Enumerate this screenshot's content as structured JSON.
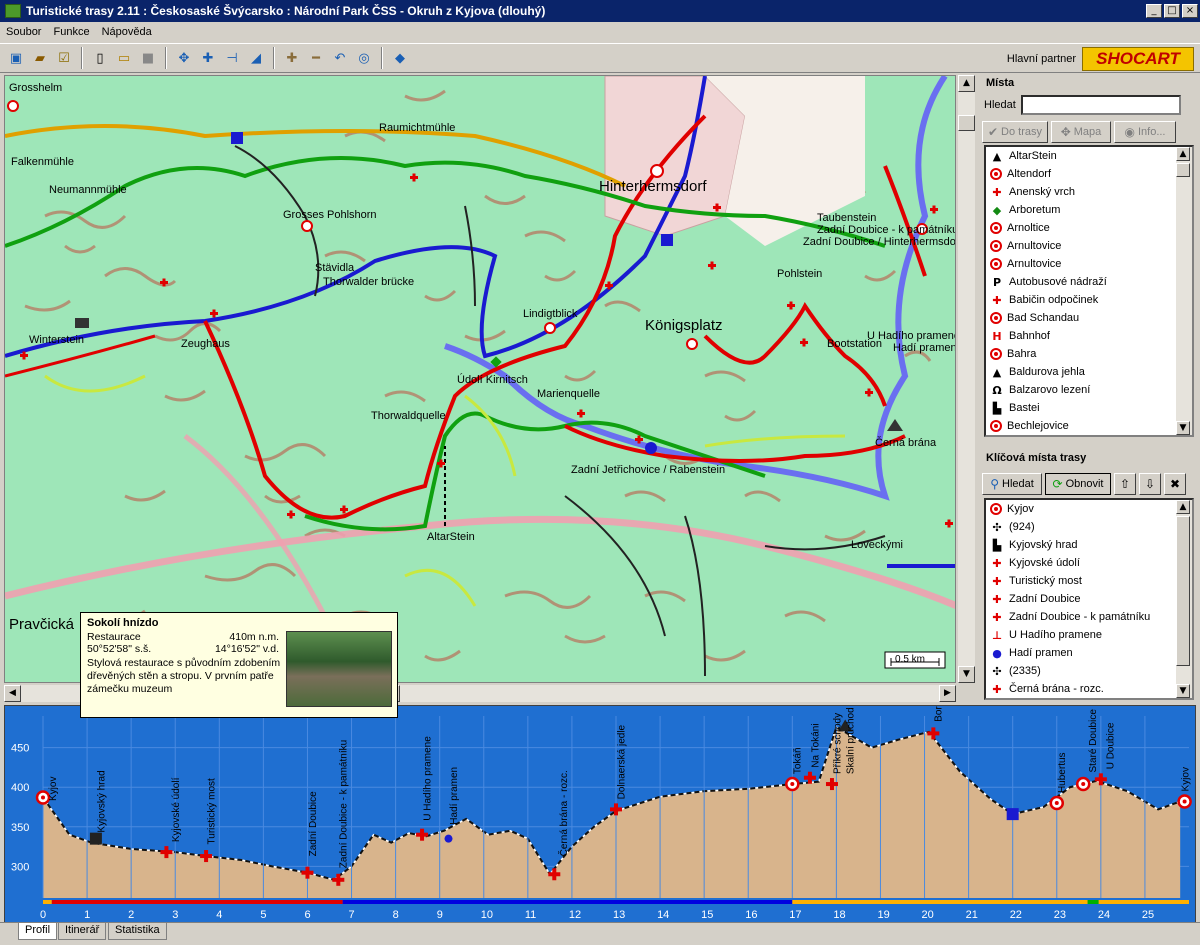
{
  "window": {
    "title": "Turistické trasy 2.11 : Českosaské Švýcarsko : Národní Park ČSS - Okruh z Kyjova (dlouhý)",
    "controls": [
      "_",
      "□",
      "×"
    ]
  },
  "menu": [
    "Soubor",
    "Funkce",
    "Nápověda"
  ],
  "toolbar": {
    "partner_label": "Hlavní partner",
    "logo_text": "SHOCART"
  },
  "map": {
    "labels": [
      {
        "text": "Grosshelm"
      },
      {
        "text": "Falkenmühle"
      },
      {
        "text": "Neumannmühle"
      },
      {
        "text": "Raumichtmühle"
      },
      {
        "text": "Grosses Pohlshorn"
      },
      {
        "text": "Stävidla"
      },
      {
        "text": "Thorwalder brücke"
      },
      {
        "text": "Winterstein"
      },
      {
        "text": "Zeughaus"
      },
      {
        "text": "Thorwaldquelle"
      },
      {
        "text": "Lindigtblick"
      },
      {
        "text": "Údolí Kirnitsch"
      },
      {
        "text": "Marienquelle"
      },
      {
        "text": "Hinterhermsdorf"
      },
      {
        "text": "Königsplatz"
      },
      {
        "text": "Taubenstein"
      },
      {
        "text": "Zadní Doubice - k památníku"
      },
      {
        "text": "Zadní Doubice / Hinterhermsdorf"
      },
      {
        "text": "Pohlstein"
      },
      {
        "text": "U Hadího pramene"
      },
      {
        "text": "Bootstation"
      },
      {
        "text": "Hadí pramen"
      },
      {
        "text": "Zadní Jetřichovice / Rabenstein"
      },
      {
        "text": "Černá brána"
      },
      {
        "text": "AltarStein"
      },
      {
        "text": "Loveckými"
      },
      {
        "text": "Pravčická"
      }
    ],
    "scale_label": "0.5 km"
  },
  "popup": {
    "title": "Sokolí hnízdo",
    "type": "Restaurace",
    "altitude": "410m n.m.",
    "lat": "50°52'58\" s.š.",
    "lon": "14°16'52\" v.d.",
    "description": "Stylová restaurace s původním zdobením dřevěných stěn a stropu. V prvním patře zámečku muzeum"
  },
  "places_panel": {
    "title": "Místa",
    "search_label": "Hledat",
    "search_value": "",
    "btn_add": "Do trasy",
    "btn_map": "Mapa",
    "btn_info": "Info...",
    "items": [
      {
        "icon": "peak",
        "label": "AltarStein"
      },
      {
        "icon": "ring",
        "label": "Altendorf"
      },
      {
        "icon": "cross",
        "label": "Anenský vrch"
      },
      {
        "icon": "diamond",
        "label": "Arboretum"
      },
      {
        "icon": "ring",
        "label": "Arnoltice"
      },
      {
        "icon": "ring",
        "label": "Arnultovice"
      },
      {
        "icon": "ring",
        "label": "Arnultovice"
      },
      {
        "icon": "bus",
        "label": "Autobusové nádraží"
      },
      {
        "icon": "cross",
        "label": "Babičin odpočinek"
      },
      {
        "icon": "ring",
        "label": "Bad Schandau"
      },
      {
        "icon": "rail",
        "label": "Bahnhof"
      },
      {
        "icon": "ring",
        "label": "Bahra"
      },
      {
        "icon": "peak",
        "label": "Baldurova jehla"
      },
      {
        "icon": "climb",
        "label": "Balzarovo lezení"
      },
      {
        "icon": "castle",
        "label": "Bastei"
      },
      {
        "icon": "ring",
        "label": "Bechlejovice"
      }
    ]
  },
  "key_points_panel": {
    "title": "Klíčová místa trasy",
    "btn_search": "Hledat",
    "btn_refresh": "Obnovit",
    "items": [
      {
        "icon": "ring",
        "label": "Kyjov"
      },
      {
        "icon": "junction",
        "label": "(924)"
      },
      {
        "icon": "castle",
        "label": "Kyjovský hrad"
      },
      {
        "icon": "cross",
        "label": "Kyjovské údolí"
      },
      {
        "icon": "cross",
        "label": "Turistický most"
      },
      {
        "icon": "cross",
        "label": "Zadní Doubice"
      },
      {
        "icon": "cross",
        "label": "Zadní Doubice - k památníku"
      },
      {
        "icon": "spring",
        "label": "U Hadího pramene"
      },
      {
        "icon": "drop",
        "label": "Hadí pramen"
      },
      {
        "icon": "junction",
        "label": "(2335)"
      },
      {
        "icon": "cross",
        "label": "Černá brána - rozc."
      }
    ]
  },
  "profile": {
    "y_ticks": [
      "450",
      "400",
      "350",
      "300"
    ],
    "x_ticks": [
      "0",
      "1",
      "2",
      "3",
      "4",
      "5",
      "6",
      "7",
      "8",
      "9",
      "10",
      "11",
      "12",
      "13",
      "14",
      "15",
      "16",
      "17",
      "18",
      "19",
      "20",
      "21",
      "22",
      "23",
      "24",
      "25"
    ],
    "labels": [
      "Kyjov",
      "Kyjovský hrad",
      "Kyjovské údolí",
      "Turistický most",
      "Zadní Doubice",
      "Zadní Doubice - k památníku",
      "U Hadího pramene",
      "Hadí pramen",
      "Černá brána - rozc.",
      "Dolnaerská jedle",
      "Tokáň",
      "Na Tokáni",
      "Příkré schody",
      "Skalní průchod",
      "Bor",
      "Hubertus",
      "Staré Doubice",
      "U Doubice",
      "Kyjov"
    ],
    "points": [
      {
        "x": 0,
        "y": 387
      },
      {
        "x": 0.6,
        "y": 340
      },
      {
        "x": 1.1,
        "y": 330
      },
      {
        "x": 2.0,
        "y": 322
      },
      {
        "x": 3.0,
        "y": 318
      },
      {
        "x": 3.7,
        "y": 313
      },
      {
        "x": 4.5,
        "y": 308
      },
      {
        "x": 5.2,
        "y": 300
      },
      {
        "x": 6.0,
        "y": 292
      },
      {
        "x": 6.6,
        "y": 283
      },
      {
        "x": 7.0,
        "y": 300
      },
      {
        "x": 7.5,
        "y": 340
      },
      {
        "x": 7.9,
        "y": 330
      },
      {
        "x": 8.3,
        "y": 342
      },
      {
        "x": 8.7,
        "y": 338
      },
      {
        "x": 9.1,
        "y": 345
      },
      {
        "x": 9.6,
        "y": 360
      },
      {
        "x": 10.1,
        "y": 340
      },
      {
        "x": 10.6,
        "y": 345
      },
      {
        "x": 11.0,
        "y": 335
      },
      {
        "x": 11.5,
        "y": 290
      },
      {
        "x": 12.0,
        "y": 325
      },
      {
        "x": 12.5,
        "y": 350
      },
      {
        "x": 13.0,
        "y": 370
      },
      {
        "x": 14.0,
        "y": 388
      },
      {
        "x": 15.0,
        "y": 395
      },
      {
        "x": 16.0,
        "y": 398
      },
      {
        "x": 17.0,
        "y": 404
      },
      {
        "x": 17.6,
        "y": 407
      },
      {
        "x": 18.0,
        "y": 476
      },
      {
        "x": 18.8,
        "y": 450
      },
      {
        "x": 19.4,
        "y": 460
      },
      {
        "x": 20.1,
        "y": 470
      },
      {
        "x": 20.8,
        "y": 420
      },
      {
        "x": 21.5,
        "y": 385
      },
      {
        "x": 22.0,
        "y": 366
      },
      {
        "x": 22.7,
        "y": 375
      },
      {
        "x": 23.3,
        "y": 400
      },
      {
        "x": 23.9,
        "y": 408
      },
      {
        "x": 24.6,
        "y": 395
      },
      {
        "x": 25.3,
        "y": 372
      },
      {
        "x": 25.8,
        "y": 382
      }
    ],
    "markers": [
      {
        "x": 0,
        "y": 387,
        "icon": "ring"
      },
      {
        "x": 1.2,
        "y": 335,
        "icon": "castle"
      },
      {
        "x": 2.8,
        "y": 318,
        "icon": "cross"
      },
      {
        "x": 3.7,
        "y": 313,
        "icon": "cross"
      },
      {
        "x": 6.0,
        "y": 292,
        "icon": "cross"
      },
      {
        "x": 6.7,
        "y": 283,
        "icon": "cross"
      },
      {
        "x": 8.6,
        "y": 340,
        "icon": "cross"
      },
      {
        "x": 9.2,
        "y": 335,
        "icon": "drop"
      },
      {
        "x": 11.6,
        "y": 290,
        "icon": "cross"
      },
      {
        "x": 13.0,
        "y": 372,
        "icon": "cross"
      },
      {
        "x": 17.0,
        "y": 404,
        "icon": "ring"
      },
      {
        "x": 17.4,
        "y": 412,
        "icon": "cross"
      },
      {
        "x": 17.9,
        "y": 404,
        "icon": "cross"
      },
      {
        "x": 18.2,
        "y": 478,
        "icon": "peak"
      },
      {
        "x": 20.2,
        "y": 468,
        "icon": "cross"
      },
      {
        "x": 22.0,
        "y": 366,
        "icon": "bus"
      },
      {
        "x": 23.0,
        "y": 380,
        "icon": "ring"
      },
      {
        "x": 23.6,
        "y": 404,
        "icon": "ring"
      },
      {
        "x": 24.0,
        "y": 410,
        "icon": "cross"
      },
      {
        "x": 25.9,
        "y": 382,
        "icon": "ring"
      }
    ],
    "x_max": 26,
    "y_min": 260,
    "y_max": 490,
    "bar_segments": [
      {
        "from": 0,
        "to": 0.2,
        "color": "#ffb000"
      },
      {
        "from": 0.2,
        "to": 6.8,
        "color": "#e00000"
      },
      {
        "from": 6.8,
        "to": 17.0,
        "color": "#0000e0"
      },
      {
        "from": 17.0,
        "to": 23.7,
        "color": "#ffb000"
      },
      {
        "from": 23.7,
        "to": 23.95,
        "color": "#00b000"
      },
      {
        "from": 23.95,
        "to": 26,
        "color": "#ffb000"
      }
    ]
  },
  "tabs": [
    "Profil",
    "Itinerář",
    "Statistika"
  ]
}
